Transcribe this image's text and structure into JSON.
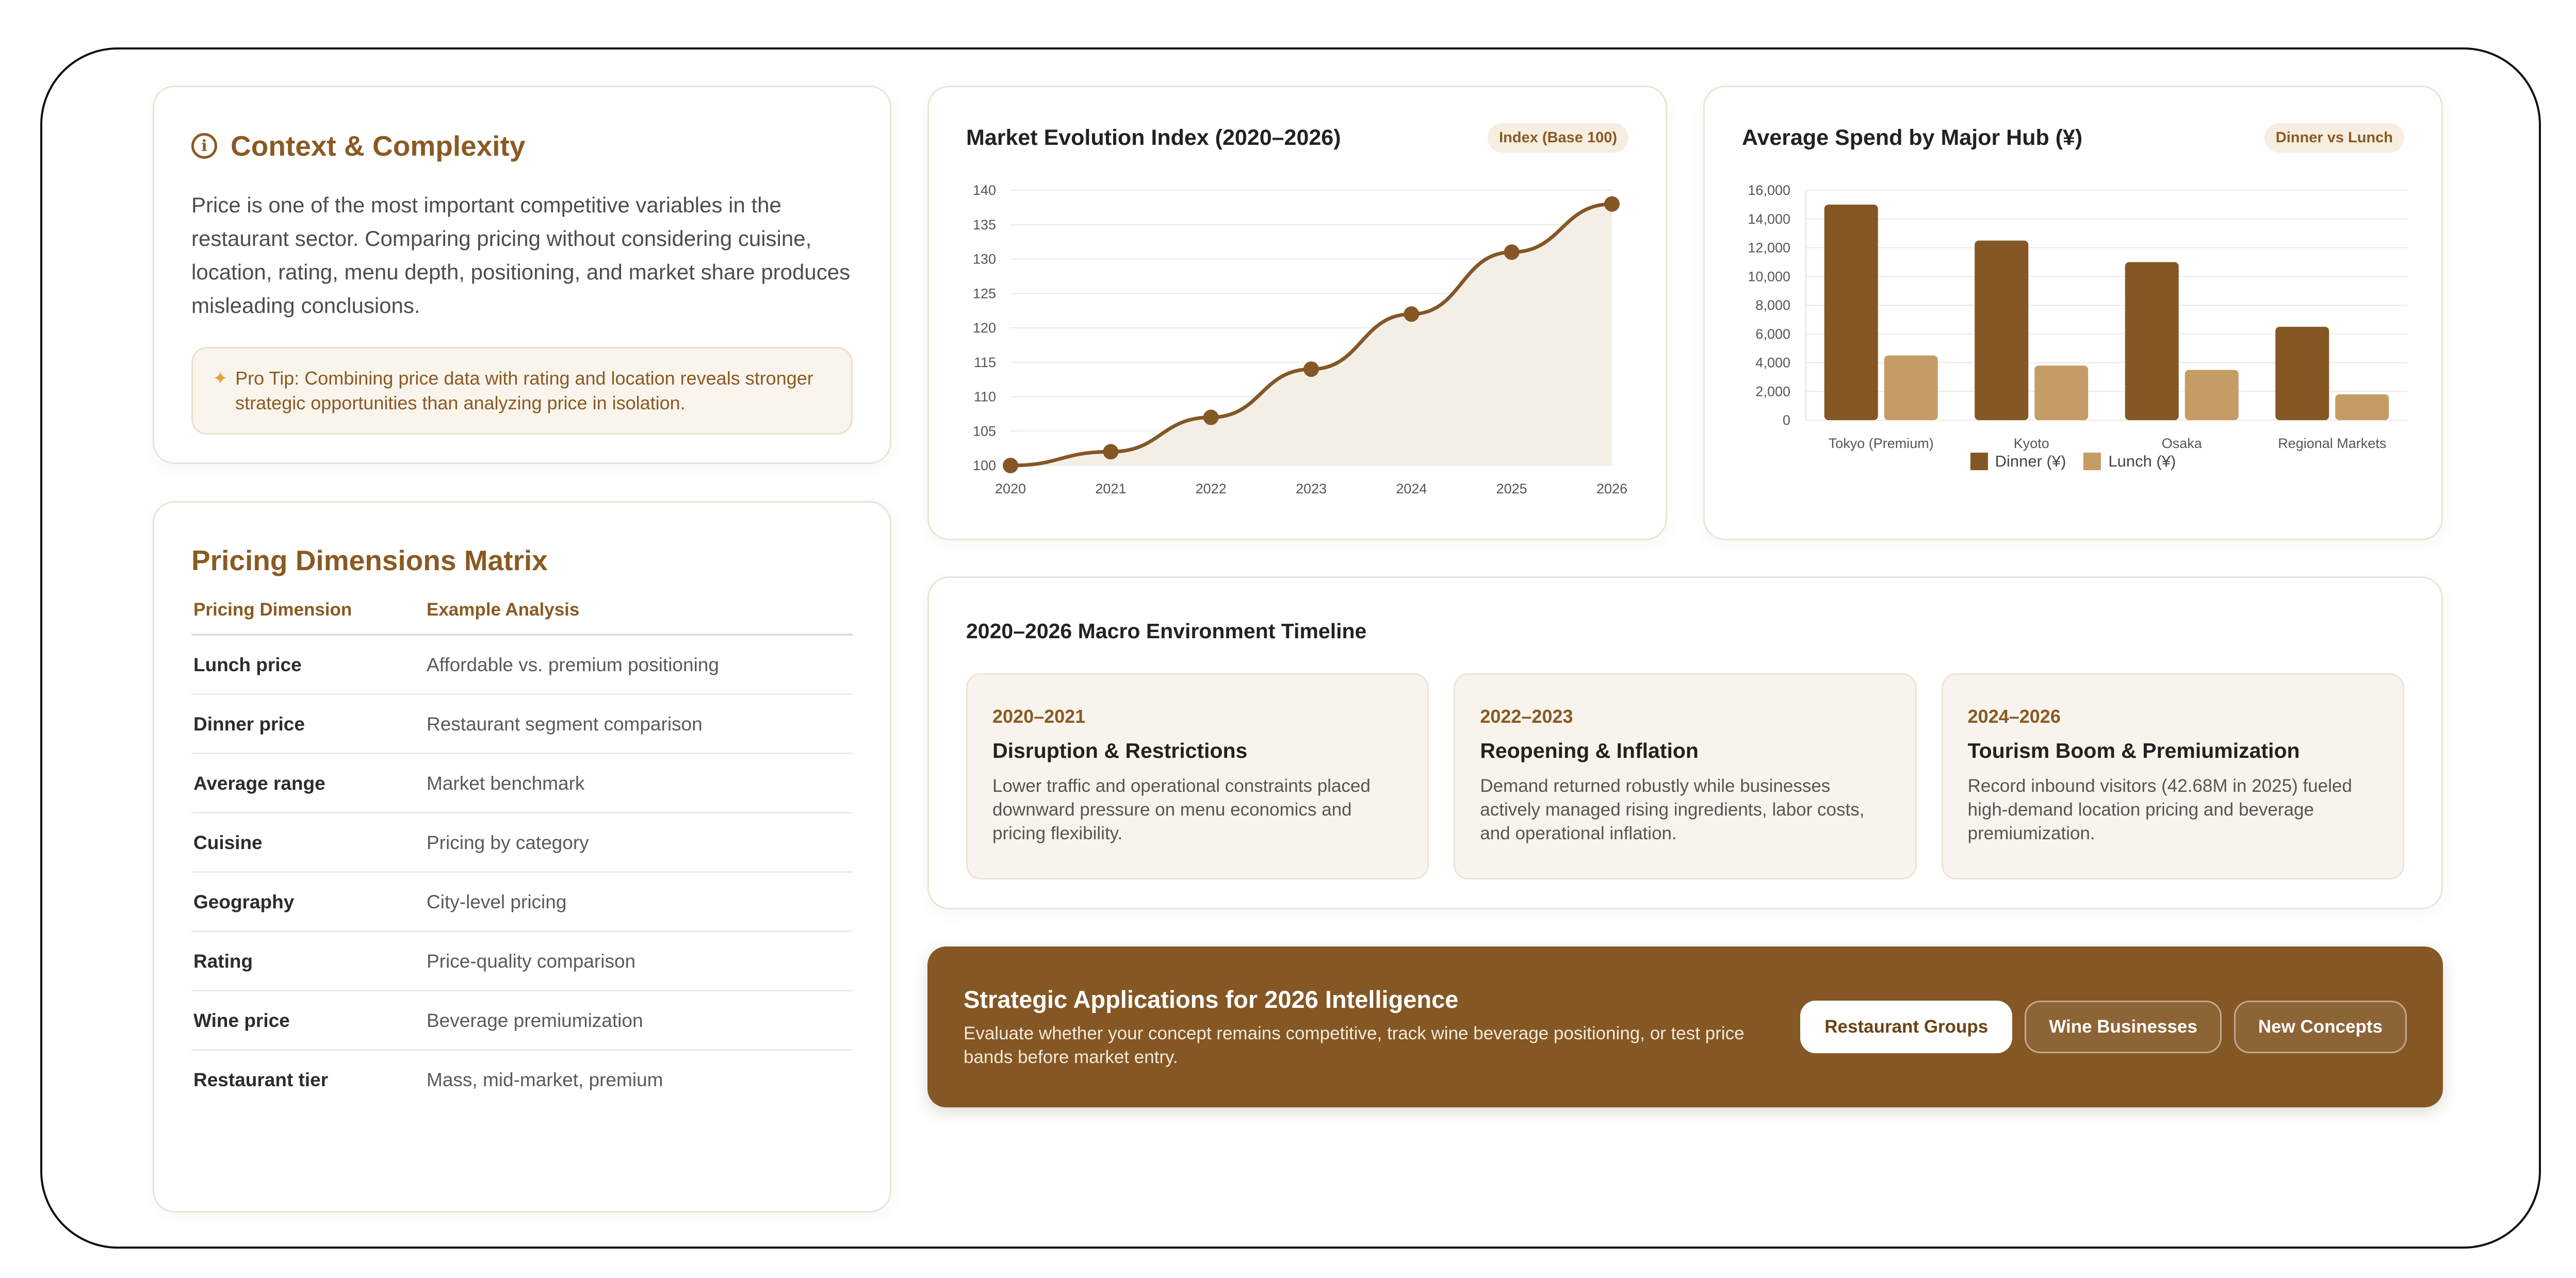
{
  "context": {
    "title": "Context & Complexity",
    "icon": "info-icon",
    "text": "Price is one of the most important competitive variables in the restaurant sector. Comparing pricing without considering cuisine, location, rating, menu depth, positioning, and market share produces misleading conclusions.",
    "tip_icon": "sparkle-icon",
    "tip": "Pro Tip: Combining price data with rating and location reveals stronger strategic opportunities than analyzing price in isolation."
  },
  "matrix": {
    "title": "Pricing Dimensions Matrix",
    "headers": [
      "Pricing Dimension",
      "Example Analysis"
    ],
    "rows": [
      [
        "Lunch price",
        "Affordable vs. premium positioning"
      ],
      [
        "Dinner price",
        "Restaurant segment comparison"
      ],
      [
        "Average range",
        "Market benchmark"
      ],
      [
        "Cuisine",
        "Pricing by category"
      ],
      [
        "Geography",
        "City-level pricing"
      ],
      [
        "Rating",
        "Price-quality comparison"
      ],
      [
        "Wine price",
        "Beverage premiumization"
      ],
      [
        "Restaurant tier",
        "Mass, mid-market, premium"
      ]
    ]
  },
  "line_card": {
    "title": "Market Evolution Index (2020–2026)",
    "badge": "Index (Base 100)"
  },
  "bar_card": {
    "title": "Average Spend by Major Hub (¥)",
    "badge": "Dinner vs Lunch"
  },
  "chart_data": [
    {
      "type": "area",
      "x": [
        "2020",
        "2021",
        "2022",
        "2023",
        "2024",
        "2025",
        "2026"
      ],
      "series": [
        {
          "values": [
            100,
            102,
            107,
            114,
            122,
            131,
            138
          ]
        }
      ],
      "ylim": [
        100,
        140
      ],
      "yticks": [
        100,
        105,
        110,
        115,
        120,
        125,
        130,
        135,
        140
      ],
      "grid": true,
      "colors": {
        "line": "#845725",
        "fill": "#f3efe7"
      }
    },
    {
      "type": "bar",
      "categories": [
        "Tokyo (Premium)",
        "Kyoto",
        "Osaka",
        "Regional Markets"
      ],
      "series": [
        {
          "name": "Dinner (¥)",
          "values": [
            15000,
            12500,
            11000,
            6500
          ],
          "color": "#845725"
        },
        {
          "name": "Lunch (¥)",
          "values": [
            4500,
            3800,
            3500,
            1800
          ],
          "color": "#c69c66"
        }
      ],
      "ylim": [
        0,
        16000
      ],
      "yticks": [
        "0",
        "2,000",
        "4,000",
        "6,000",
        "8,000",
        "10,000",
        "12,000",
        "14,000",
        "16,000"
      ],
      "grid": true,
      "legend": "bottom"
    }
  ],
  "timeline": {
    "title": "2020–2026 Macro Environment Timeline",
    "items": [
      {
        "years": "2020–2021",
        "title": "Disruption & Restrictions",
        "desc": "Lower traffic and operational constraints placed downward pressure on menu economics and pricing flexibility."
      },
      {
        "years": "2022–2023",
        "title": "Reopening & Inflation",
        "desc": "Demand returned robustly while businesses actively managed rising ingredients, labor costs, and operational inflation."
      },
      {
        "years": "2024–2026",
        "title": "Tourism Boom & Premiumization",
        "desc": "Record inbound visitors (42.68M in 2025) fueled high-demand location pricing and beverage premiumization."
      }
    ]
  },
  "strategic": {
    "title": "Strategic Applications for 2026 Intelligence",
    "desc": "Evaluate whether your concept remains competitive, track wine beverage positioning, or test price bands before market entry.",
    "buttons": [
      "Restaurant Groups",
      "Wine Businesses",
      "New Concepts"
    ]
  }
}
